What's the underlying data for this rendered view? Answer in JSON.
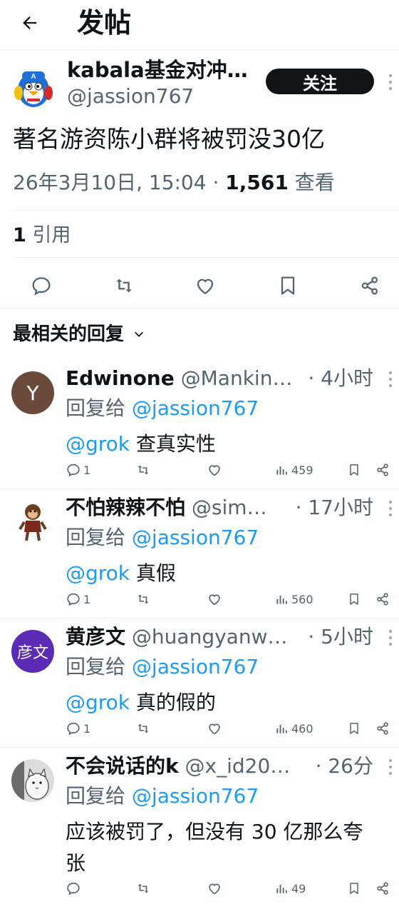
{
  "header": {
    "title": "发帖"
  },
  "post": {
    "author_name": "kabala基金对冲…",
    "author_handle": "@jassion767",
    "follow_label": "关注",
    "text": "著名游资陈小群将被罚没30亿",
    "timestamp": "26年3月10日, 15:04 · ",
    "views_count": "1,561",
    "views_label": " 查看",
    "quote_count": "1",
    "quote_label": " 引用"
  },
  "replies_sort": {
    "label": "最相关的回复"
  },
  "replies": [
    {
      "avatar_letter": "Y",
      "avatar_color": "#6b4a3c",
      "name": "Edwinone",
      "handle": "@Mankin…",
      "time": "· 4小时",
      "reply_prefix": "回复给",
      "reply_to": "@jassion767",
      "mention": "@grok",
      "text": " 查真实性",
      "replies": "1",
      "views": "459"
    },
    {
      "avatar_letter": "",
      "name": "不怕辣辣不怕",
      "handle": "@sim…",
      "time": "· 17小时",
      "reply_prefix": "回复给",
      "reply_to": "@jassion767",
      "mention": "@grok",
      "text": " 真假",
      "replies": "1",
      "views": "560"
    },
    {
      "avatar_letter": "彦文",
      "avatar_color": "#5b2bb5",
      "name": "黄彦文",
      "handle": "@huangyanw…",
      "time": "· 5小时",
      "reply_prefix": "回复给",
      "reply_to": "@jassion767",
      "mention": "@grok",
      "text": " 真的假的",
      "replies": "1",
      "views": "460"
    },
    {
      "avatar_letter": "",
      "name": "不会说话的k",
      "handle": "@x_id20…",
      "time": "· 26分",
      "reply_prefix": "回复给",
      "reply_to": "@jassion767",
      "mention": "",
      "text": "应该被罚了，但没有 30 亿那么夸张",
      "replies": "",
      "views": "49"
    }
  ],
  "colors": {
    "accent": "#1d9bf0",
    "text": "#0f1419",
    "secondary": "#536471",
    "divider": "#eff3f4"
  }
}
